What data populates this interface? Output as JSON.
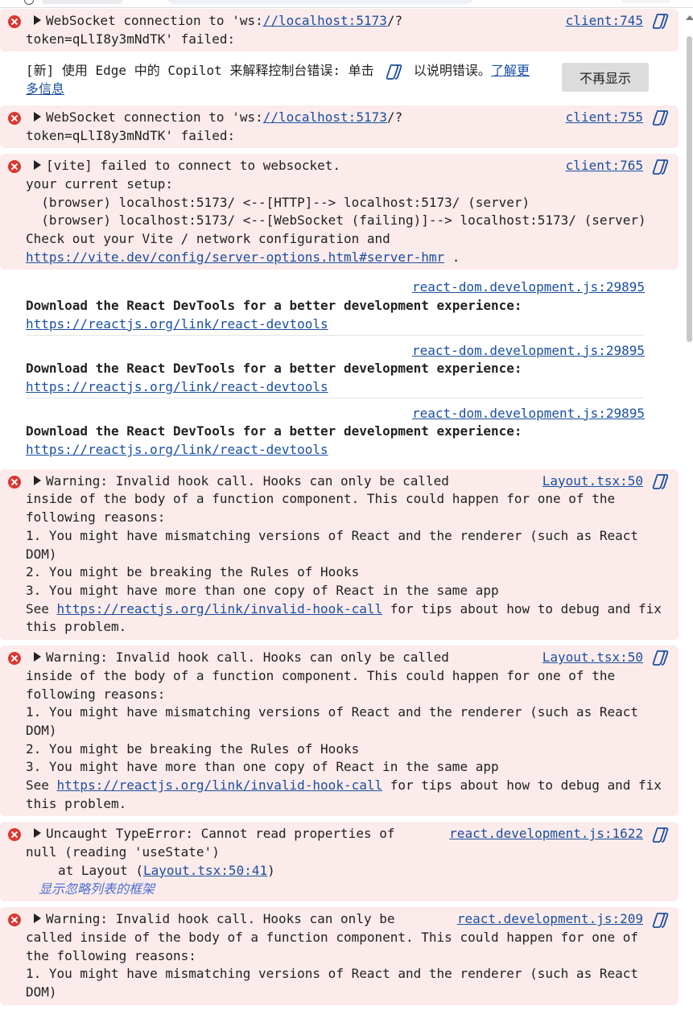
{
  "colors": {
    "error_bg": "#fcebeb",
    "link": "#1a4fa0",
    "error_icon": "#dc362e",
    "button_bg": "#dcdcdc"
  },
  "notice": {
    "text_before": "[新] 使用 Edge 中的 Copilot 来解释控制台错误: 单击 ",
    "text_after": " 以说明错误。",
    "link": "了解更多信息",
    "button": "不再显示"
  },
  "messages": [
    {
      "source": "client:745",
      "first": "WebSocket connection to 'ws:",
      "first_link": "//localhost:5173",
      "first_after": "/?",
      "rest": "token=qLlI8y3mNdTK' failed:"
    },
    {
      "source": "client:755",
      "first": "WebSocket connection to 'ws:",
      "first_link": "//localhost:5173",
      "first_after": "/?",
      "rest": "token=qLlI8y3mNdTK' failed:"
    },
    {
      "source": "client:765",
      "first": "[vite] failed to connect to websocket.",
      "lines": [
        "your current setup:",
        "  (browser) localhost:5173/ <--[HTTP]--> localhost:5173/ (server)",
        "  (browser) localhost:5173/ <--[WebSocket (failing)]--> localhost:5173/ (server)",
        "Check out your Vite / network configuration and "
      ],
      "link": "https://vite.dev/config/server-options.html#server-hmr",
      "after_link": " ."
    }
  ],
  "info_messages": [
    {
      "source": "react-dom.development.js:29895",
      "text": "Download the React DevTools for a better development experience:",
      "link": "https://reactjs.org/link/react-devtools"
    },
    {
      "source": "react-dom.development.js:29895",
      "text": "Download the React DevTools for a better development experience:",
      "link": "https://reactjs.org/link/react-devtools"
    },
    {
      "source": "react-dom.development.js:29895",
      "text": "Download the React DevTools for a better development experience:",
      "link": "https://reactjs.org/link/react-devtools"
    }
  ],
  "hook_warnings": [
    {
      "source": "Layout.tsx:50",
      "first": "Warning: Invalid hook call. Hooks can only be called",
      "body": "inside of the body of a function component. This could happen for one of the following reasons:\n1. You might have mismatching versions of React and the renderer (such as React DOM)\n2. You might be breaking the Rules of Hooks\n3. You might have more than one copy of React in the same app\nSee ",
      "link": "https://reactjs.org/link/invalid-hook-call",
      "after_link": " for tips about how to debug and fix this problem."
    },
    {
      "source": "Layout.tsx:50",
      "first": "Warning: Invalid hook call. Hooks can only be called",
      "body": "inside of the body of a function component. This could happen for one of the following reasons:\n1. You might have mismatching versions of React and the renderer (such as React DOM)\n2. You might be breaking the Rules of Hooks\n3. You might have more than one copy of React in the same app\nSee ",
      "link": "https://reactjs.org/link/invalid-hook-call",
      "after_link": " for tips about how to debug and fix this problem."
    }
  ],
  "type_error": {
    "source": "react.development.js:1622",
    "first": "Uncaught TypeError: Cannot read properties of",
    "second": "null (reading 'useState')",
    "frame_prefix": "at Layout (",
    "frame_link": "Layout.tsx:50:41",
    "frame_suffix": ")",
    "ignore_link": "显示忽略列表的框架"
  },
  "last_warning": {
    "source": "react.development.js:209",
    "first": "Warning: Invalid hook call. Hooks can only be",
    "body": "called inside of the body of a function component. This could happen for one of the following reasons:\n1. You might have mismatching versions of React and the renderer (such as React DOM)"
  }
}
